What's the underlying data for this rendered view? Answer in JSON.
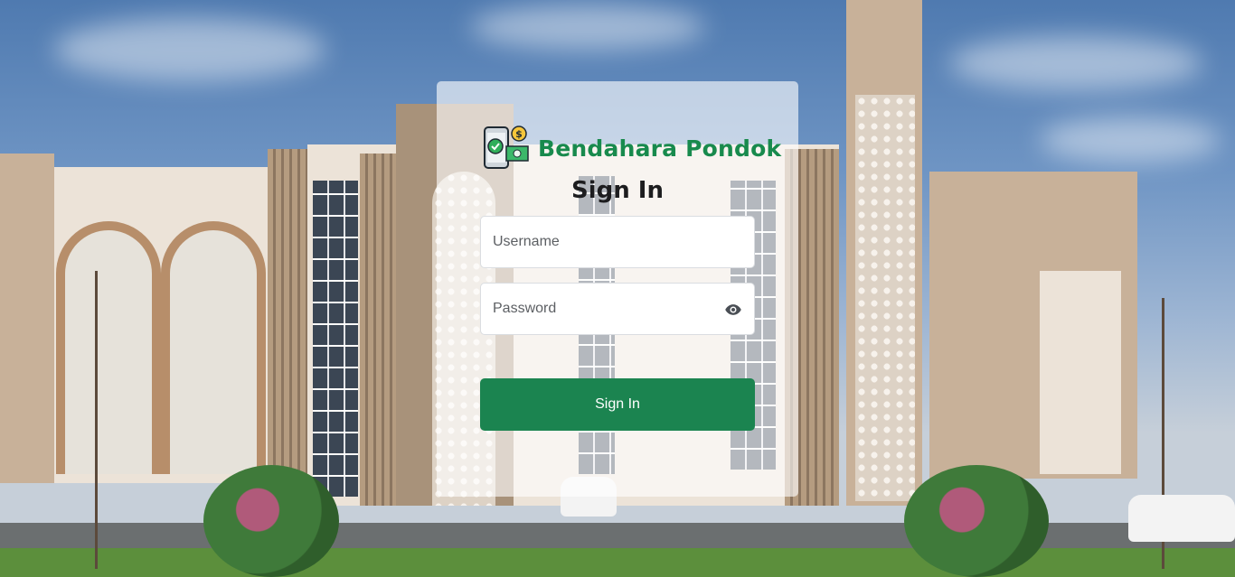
{
  "brand": {
    "name": "Bendahara Pondok",
    "logo_icon": "phone-money-icon"
  },
  "form": {
    "title": "Sign In",
    "username_placeholder": "Username",
    "password_placeholder": "Password",
    "password_toggle_icon": "eye-icon",
    "submit_label": "Sign In"
  },
  "colors": {
    "brand": "#188a4d",
    "button": "#1b8450"
  }
}
